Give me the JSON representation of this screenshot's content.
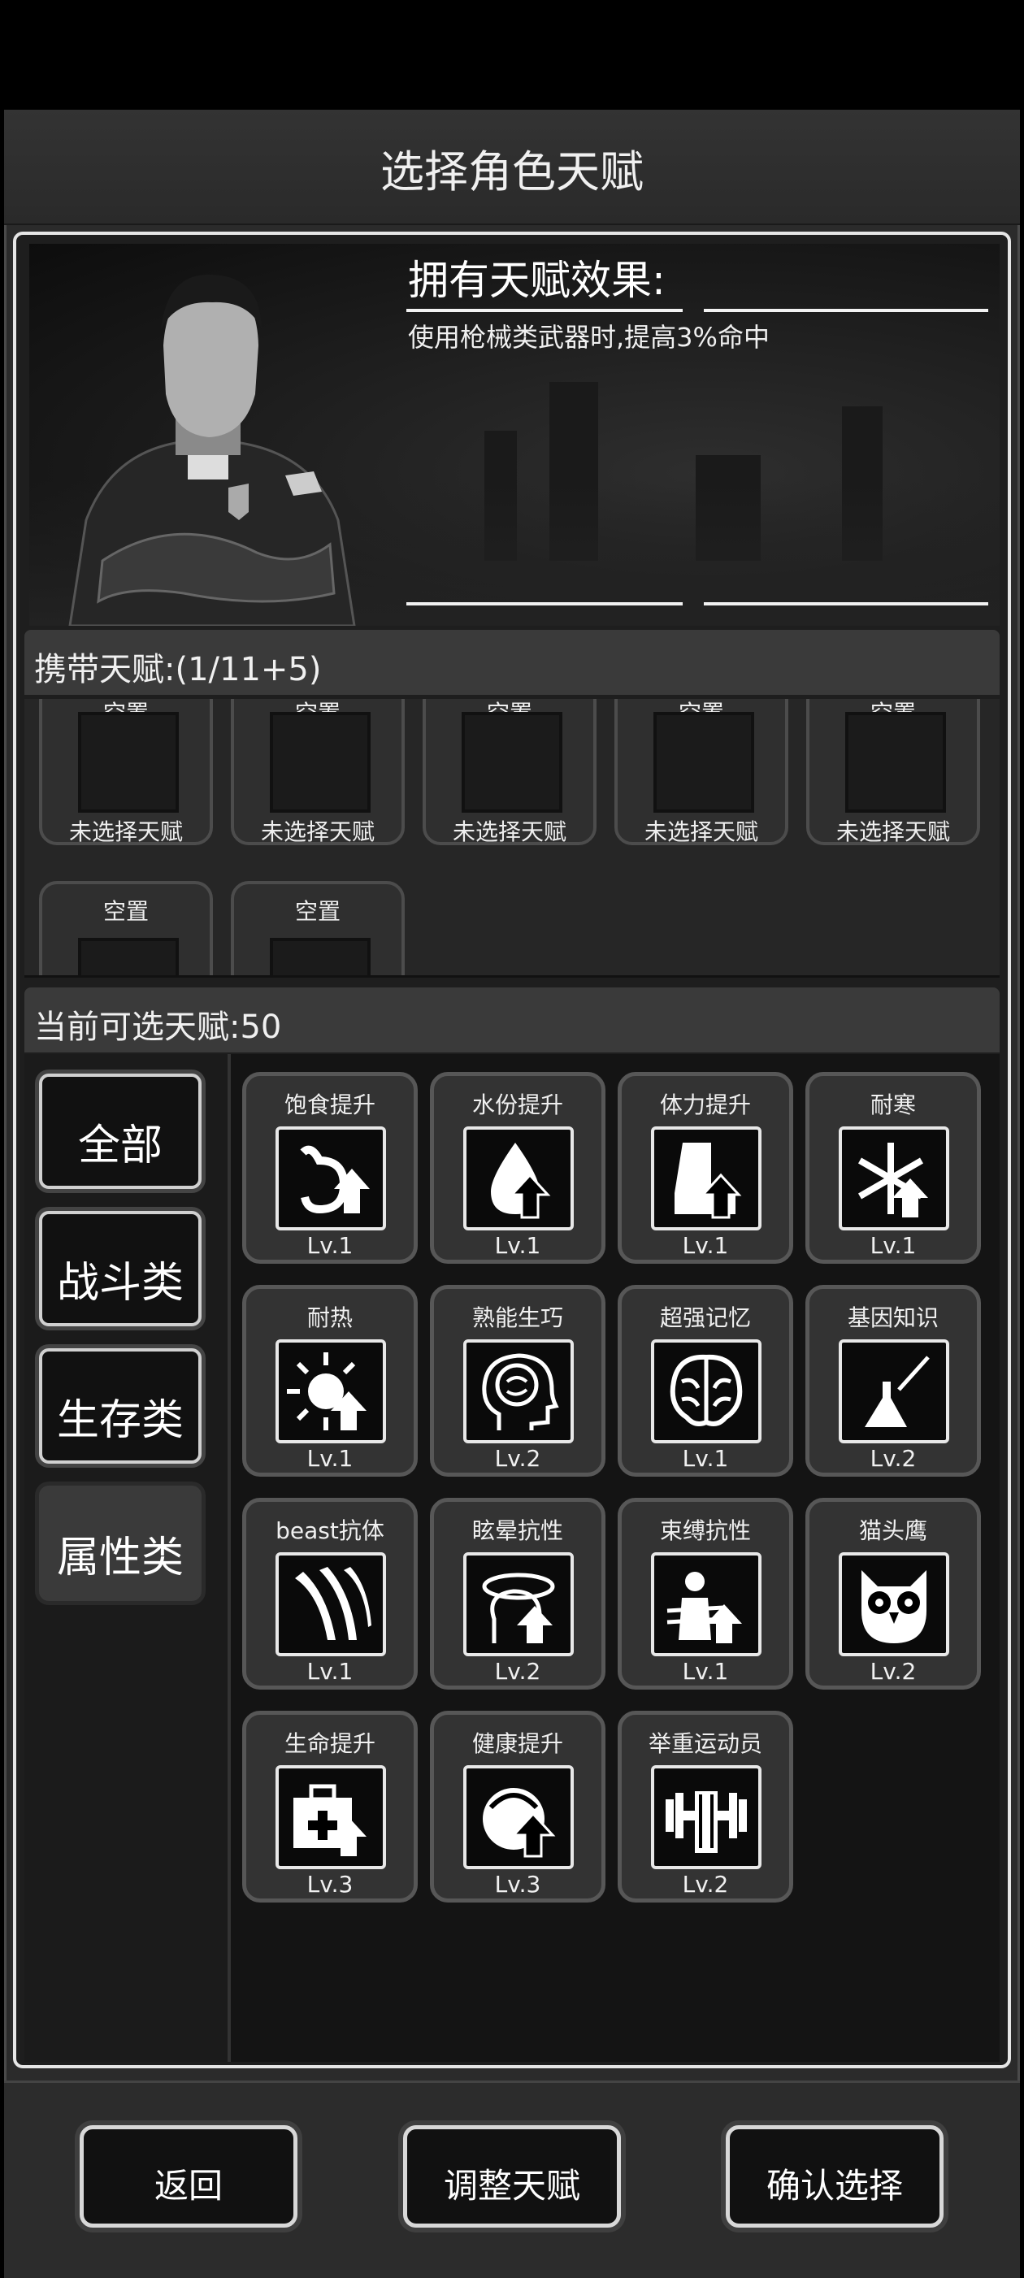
{
  "header": {
    "title": "选择角色天赋"
  },
  "effect": {
    "title": "拥有天赋效果:",
    "text": "使用枪械类武器时,提高3%命中"
  },
  "carry": {
    "title": "携带天赋:(1/11+5)",
    "slots": [
      {
        "top": "空置",
        "bottom": "未选择天赋"
      },
      {
        "top": "空置",
        "bottom": "未选择天赋"
      },
      {
        "top": "空置",
        "bottom": "未选择天赋"
      },
      {
        "top": "空置",
        "bottom": "未选择天赋"
      },
      {
        "top": "空置",
        "bottom": "未选择天赋"
      },
      {
        "top": "空置",
        "bottom": ""
      },
      {
        "top": "空置",
        "bottom": ""
      }
    ]
  },
  "available": {
    "title": "当前可选天赋:50",
    "categories": [
      {
        "label": "全部",
        "active": false
      },
      {
        "label": "战斗类",
        "active": false
      },
      {
        "label": "生存类",
        "active": false
      },
      {
        "label": "属性类",
        "active": true
      }
    ],
    "talents": [
      {
        "name": "饱食提升",
        "level": "Lv.1",
        "icon": "stomach-up-icon"
      },
      {
        "name": "水份提升",
        "level": "Lv.1",
        "icon": "water-drop-up-icon"
      },
      {
        "name": "体力提升",
        "level": "Lv.1",
        "icon": "boot-up-icon"
      },
      {
        "name": "耐寒",
        "level": "Lv.1",
        "icon": "snowflake-up-icon"
      },
      {
        "name": "耐热",
        "level": "Lv.1",
        "icon": "sun-up-icon"
      },
      {
        "name": "熟能生巧",
        "level": "Lv.2",
        "icon": "brain-head-icon"
      },
      {
        "name": "超强记忆",
        "level": "Lv.1",
        "icon": "brain-icon"
      },
      {
        "name": "基因知识",
        "level": "Lv.2",
        "icon": "flask-icon"
      },
      {
        "name": "beast抗体",
        "level": "Lv.1",
        "icon": "claw-icon"
      },
      {
        "name": "眩晕抗性",
        "level": "Lv.2",
        "icon": "dizzy-head-icon"
      },
      {
        "name": "束缚抗性",
        "level": "Lv.1",
        "icon": "bound-figure-icon"
      },
      {
        "name": "猫头鹰",
        "level": "Lv.2",
        "icon": "owl-icon"
      },
      {
        "name": "生命提升",
        "level": "Lv.3",
        "icon": "medkit-up-icon"
      },
      {
        "name": "健康提升",
        "level": "Lv.3",
        "icon": "heart-up-icon"
      },
      {
        "name": "举重运动员",
        "level": "Lv.2",
        "icon": "dumbbell-icon"
      }
    ]
  },
  "footer": {
    "back": "返回",
    "adjust": "调整天赋",
    "confirm": "确认选择"
  }
}
